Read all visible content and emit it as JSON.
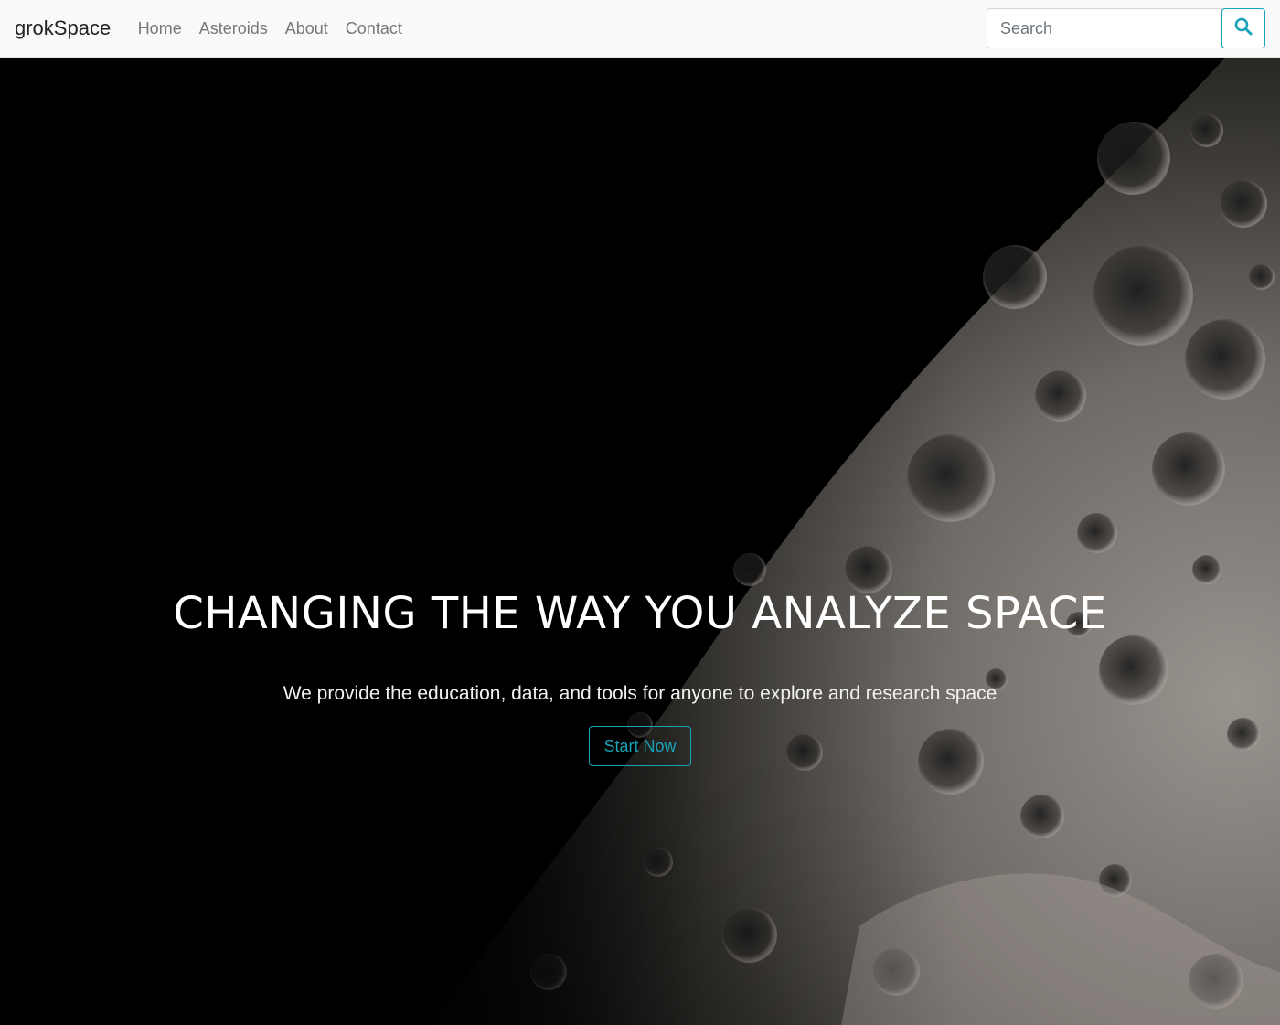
{
  "navbar": {
    "brand": "grokSpace",
    "links": [
      "Home",
      "Asteroids",
      "About",
      "Contact"
    ],
    "search": {
      "placeholder": "Search",
      "value": ""
    },
    "search_icon": "search-icon",
    "accent_color": "#17a2b8"
  },
  "hero": {
    "background": "moon-surface-image",
    "title": "CHANGING THE WAY YOU ANALYZE SPACE",
    "subtitle": "We provide the education, data, and tools for anyone to explore and research space",
    "cta_label": "Start Now"
  }
}
